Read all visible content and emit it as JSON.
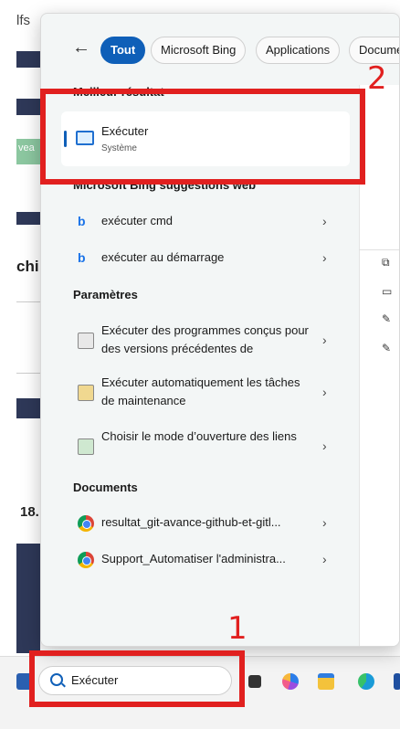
{
  "background": {
    "fragment_top": "lfs",
    "fragment_green": "vea",
    "fragment_mid": "chi",
    "fragment_date": "18."
  },
  "panel": {
    "tabs": [
      "Tout",
      "Microsoft Bing",
      "Applications",
      "Docume"
    ],
    "best_match_header": "Meilleur résultat",
    "best_match": {
      "title": "Exécuter",
      "subtitle": "Système"
    },
    "bing_header": "Microsoft Bing suggestions web",
    "bing_items": [
      "exécuter cmd",
      "exécuter au démarrage"
    ],
    "settings_header": "Paramètres",
    "settings_items": [
      "Exécuter des programmes conçus pour des versions précédentes de",
      "Exécuter automatiquement les tâches de maintenance",
      "Choisir le mode d’ouverture des liens"
    ],
    "documents_header": "Documents",
    "documents_items": [
      "resultat_git-avance-github-et-gitl...",
      "Support_Automatiser l'administra..."
    ]
  },
  "search": {
    "value": "Exécuter"
  },
  "annotations": {
    "label_1": "1",
    "label_2": "2",
    "color": "#e1201f"
  },
  "accent_color": "#0f5fb8"
}
